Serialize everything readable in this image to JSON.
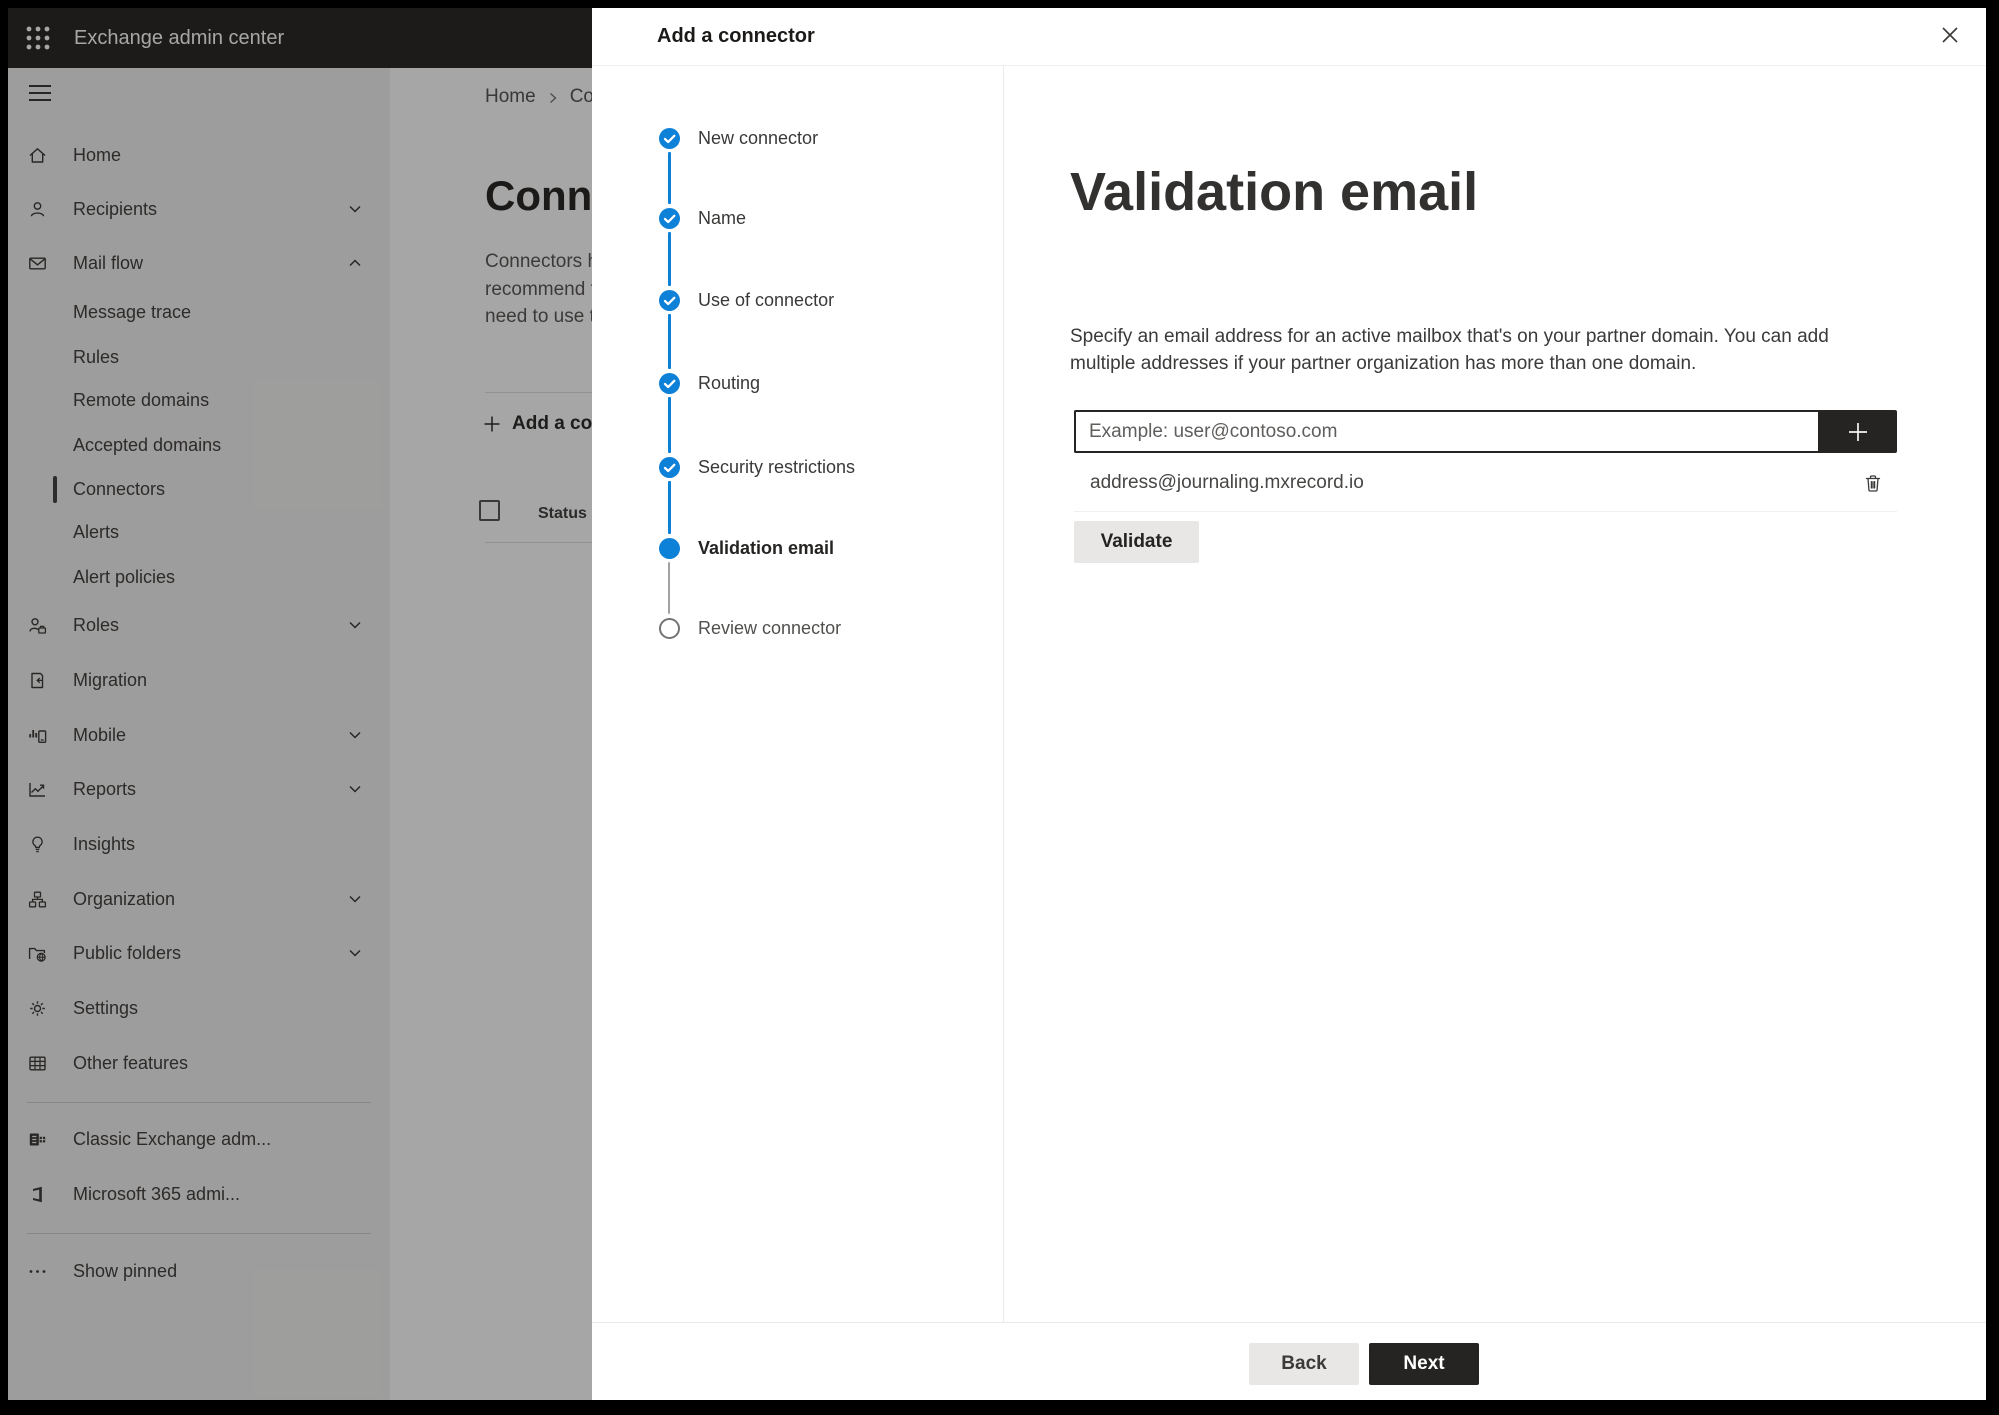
{
  "appbar": {
    "title": "Exchange admin center"
  },
  "sidebar": {
    "items": [
      {
        "label": "Home"
      },
      {
        "label": "Recipients",
        "chevron": "down"
      },
      {
        "label": "Mail flow",
        "chevron": "up"
      },
      {
        "label": "Message trace"
      },
      {
        "label": "Rules"
      },
      {
        "label": "Remote domains"
      },
      {
        "label": "Accepted domains"
      },
      {
        "label": "Connectors",
        "selected": true
      },
      {
        "label": "Alerts"
      },
      {
        "label": "Alert policies"
      },
      {
        "label": "Roles",
        "chevron": "down"
      },
      {
        "label": "Migration"
      },
      {
        "label": "Mobile",
        "chevron": "down"
      },
      {
        "label": "Reports",
        "chevron": "down"
      },
      {
        "label": "Insights"
      },
      {
        "label": "Organization",
        "chevron": "down"
      },
      {
        "label": "Public folders",
        "chevron": "down"
      },
      {
        "label": "Settings"
      },
      {
        "label": "Other features"
      },
      {
        "label": "Classic Exchange adm..."
      },
      {
        "label": "Microsoft 365 admi..."
      },
      {
        "label": "Show pinned"
      }
    ]
  },
  "background_page": {
    "breadcrumb_home": "Home",
    "breadcrumb_current": "Conne",
    "title": "Connec",
    "body_line1": "Connectors help",
    "body_line2": "recommend that",
    "body_line3": "need to use ther",
    "add_button_label": "Add a conn",
    "status_header": "Status"
  },
  "panel": {
    "title": "Add a connector",
    "steps": [
      {
        "label": "New connector",
        "state": "done"
      },
      {
        "label": "Name",
        "state": "done"
      },
      {
        "label": "Use of connector",
        "state": "done"
      },
      {
        "label": "Routing",
        "state": "done"
      },
      {
        "label": "Security restrictions",
        "state": "done"
      },
      {
        "label": "Validation email",
        "state": "current"
      },
      {
        "label": "Review connector",
        "state": "upcoming"
      }
    ],
    "heading": "Validation email",
    "description": "Specify an email address for an active mailbox that's on your partner domain. You can add multiple addresses if your partner organization has more than one domain.",
    "email_placeholder": "Example: user@contoso.com",
    "email_value": "",
    "addresses": [
      {
        "email": "address@journaling.mxrecord.io"
      }
    ],
    "validate_label": "Validate",
    "back_label": "Back",
    "next_label": "Next"
  },
  "colors": {
    "accent_blue": "#0d80d8",
    "dark_button": "#252423",
    "panel_bg": "#ffffff"
  }
}
